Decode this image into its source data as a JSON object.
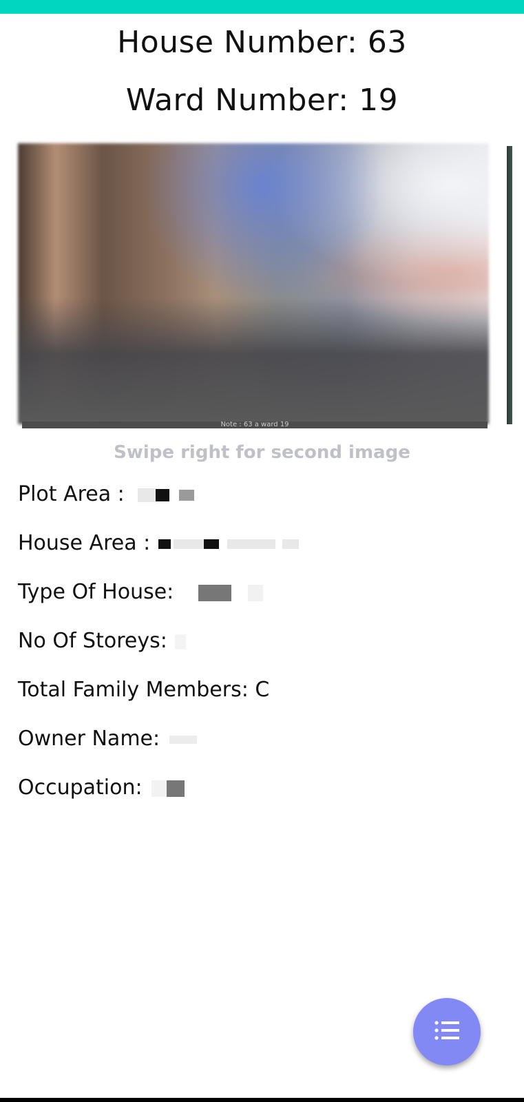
{
  "header": {
    "house_title": "House Number: 63",
    "ward_title": "Ward Number: 19"
  },
  "gallery": {
    "caption": "Note : 63 a ward 19",
    "hint": "Swipe right for second image"
  },
  "details": {
    "plot_area_label": "Plot Area :",
    "house_area_label": "House Area :",
    "type_of_house_label": "Type Of House:",
    "storeys_label": "No Of Storeys:",
    "family_members_label": "Total Family Members:",
    "family_members_value": "C",
    "owner_name_label": "Owner Name:",
    "occupation_label": "Occupation:"
  },
  "fab": {
    "icon": "list-icon"
  },
  "colors": {
    "status_bar": "#00d6c0",
    "fab": "#8389f4",
    "hint_text": "#bfc0c8"
  }
}
